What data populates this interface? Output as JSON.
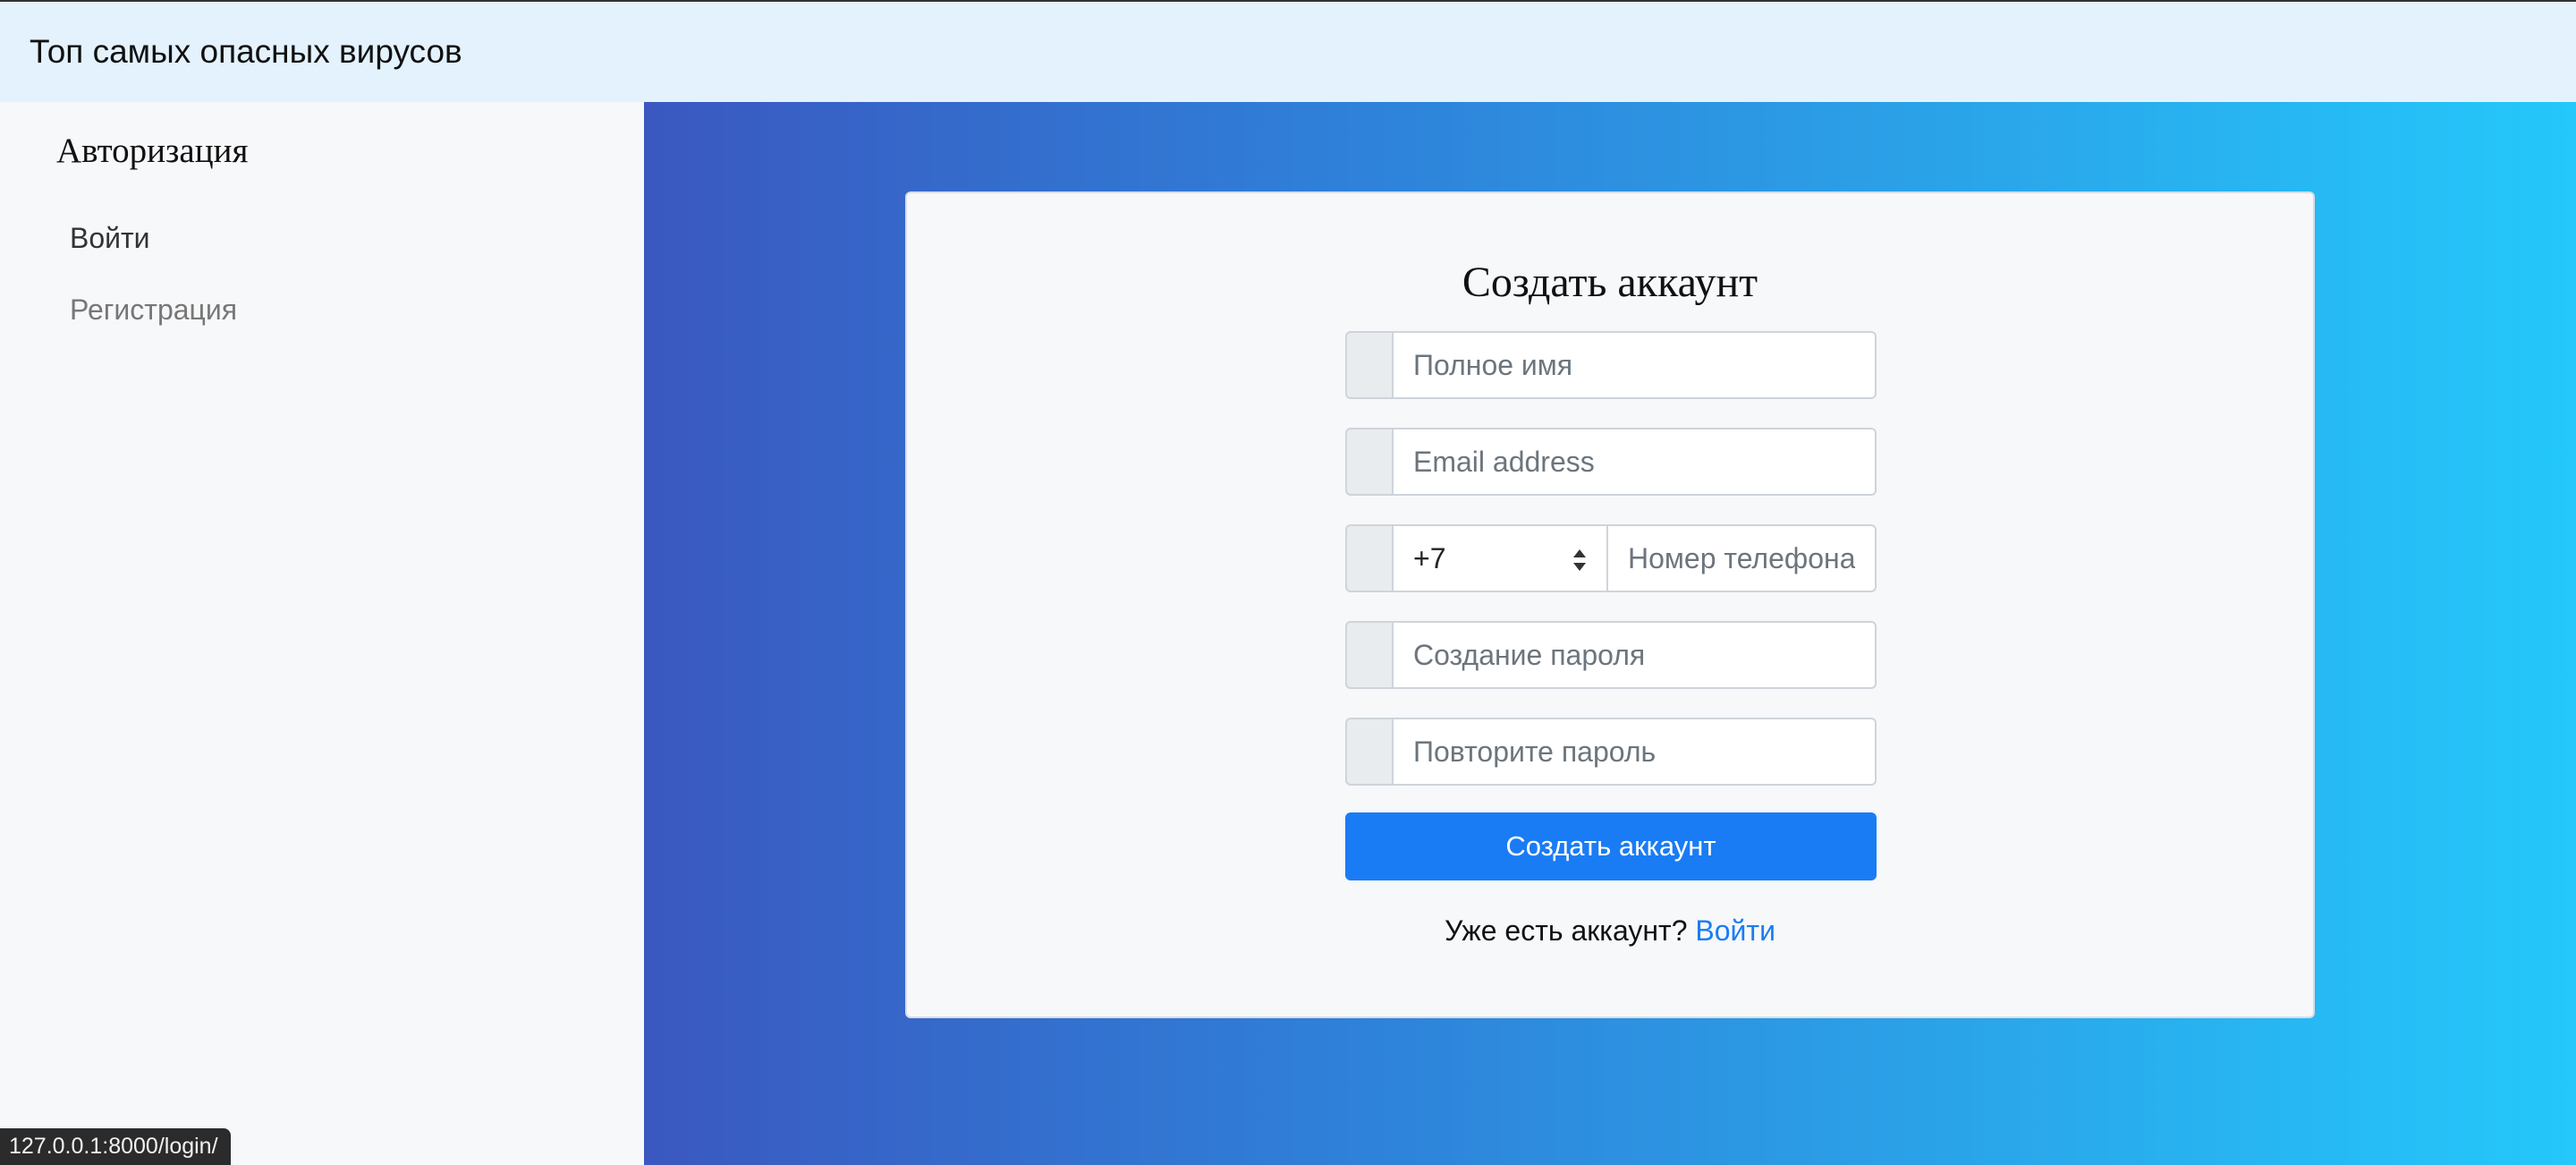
{
  "header": {
    "brand": "Топ самых опасных вирусов"
  },
  "sidebar": {
    "title": "Авторизация",
    "items": [
      {
        "label": "Войти"
      },
      {
        "label": "Регистрация"
      }
    ]
  },
  "form": {
    "title": "Создать аккаунт",
    "full_name_placeholder": "Полное имя",
    "email_placeholder": "Email address",
    "country_code": "+7",
    "phone_placeholder": "Номер телефона",
    "password_placeholder": "Создание пароля",
    "repeat_password_placeholder": "Повторите пароль",
    "submit_label": "Создать аккаунт",
    "footer_text": "Уже есть аккаунт?",
    "footer_link": "Войти"
  },
  "statusbar": {
    "url": "127.0.0.1:8000/login/"
  },
  "colors": {
    "header_bg": "#e3f2fd",
    "sidebar_bg": "#f7f8fa",
    "gradient_start": "#3a58c0",
    "gradient_end": "#24c8fb",
    "primary": "#1a7cf5"
  }
}
